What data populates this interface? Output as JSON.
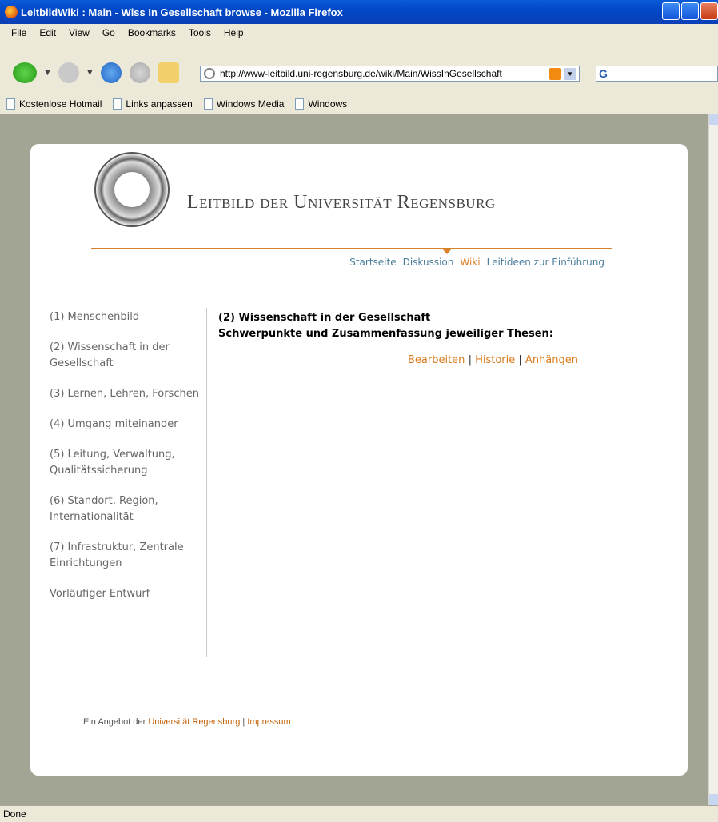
{
  "window": {
    "title": "LeitbildWiki : Main - Wiss In Gesellschaft browse - Mozilla Firefox"
  },
  "menu": [
    "File",
    "Edit",
    "View",
    "Go",
    "Bookmarks",
    "Tools",
    "Help"
  ],
  "address": {
    "url": "http://www-leitbild.uni-regensburg.de/wiki/Main/WissInGesellschaft"
  },
  "bookmarks": [
    "Kostenlose Hotmail",
    "Links anpassen",
    "Windows Media",
    "Windows"
  ],
  "site": {
    "title": "Leitbild der Universität Regensburg",
    "nav": [
      "Startseite",
      "Diskussion",
      "Wiki",
      "Leitideen zur Einführung"
    ],
    "active_nav": "Wiki"
  },
  "sidebar": [
    "(1) Menschenbild",
    "(2) Wissenschaft in der Gesellschaft",
    "(3) Lernen, Lehren, Forschen",
    "(4) Umgang miteinander",
    "(5) Leitung, Verwaltung, Qualitätssicherung",
    "(6) Standort, Region, Internationalität",
    "(7) Infrastruktur, Zentrale Einrichtungen",
    "Vorläufiger Entwurf"
  ],
  "main": {
    "heading": "(2) Wissenschaft in der Gesellschaft",
    "subheading": "Schwerpunkte und Zusammenfassung jeweiliger Thesen:",
    "actions": [
      "Bearbeiten",
      "Historie",
      "Anhängen"
    ]
  },
  "footer": {
    "prefix": "Ein Angebot der",
    "link1": "Universität Regensburg",
    "separator": "|",
    "link2": "Impressum"
  },
  "status": "Done",
  "colors": {
    "accent": "#d9822b",
    "nav_link": "#4a7e9b",
    "page_bg": "#a3a594"
  }
}
